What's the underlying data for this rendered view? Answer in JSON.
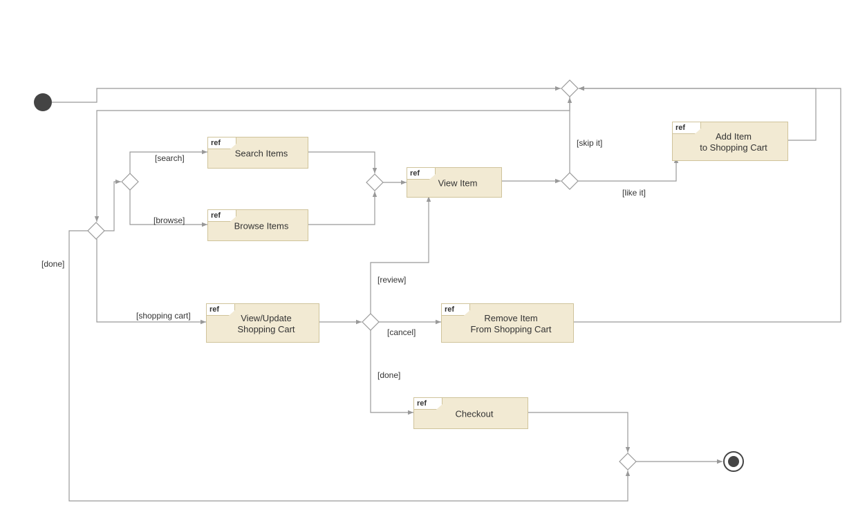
{
  "refTag": "ref",
  "nodes": {
    "searchItems": {
      "label": "Search Items"
    },
    "browseItems": {
      "label": "Browse Items"
    },
    "viewItem": {
      "label": "View Item"
    },
    "viewUpdateCart": {
      "line1": "View/Update",
      "line2": "Shopping Cart"
    },
    "removeItem": {
      "line1": "Remove Item",
      "line2": "From Shopping Cart"
    },
    "addItem": {
      "line1": "Add Item",
      "line2": "to Shopping Cart"
    },
    "checkout": {
      "label": "Checkout"
    }
  },
  "guards": {
    "search": "[search]",
    "browse": "[browse]",
    "shoppingCart": "[shopping cart]",
    "review": "[review]",
    "cancel": "[cancel]",
    "done1": "[done]",
    "done2": "[done]",
    "skipIt": "[skip it]",
    "likeIt": "[like it]"
  }
}
